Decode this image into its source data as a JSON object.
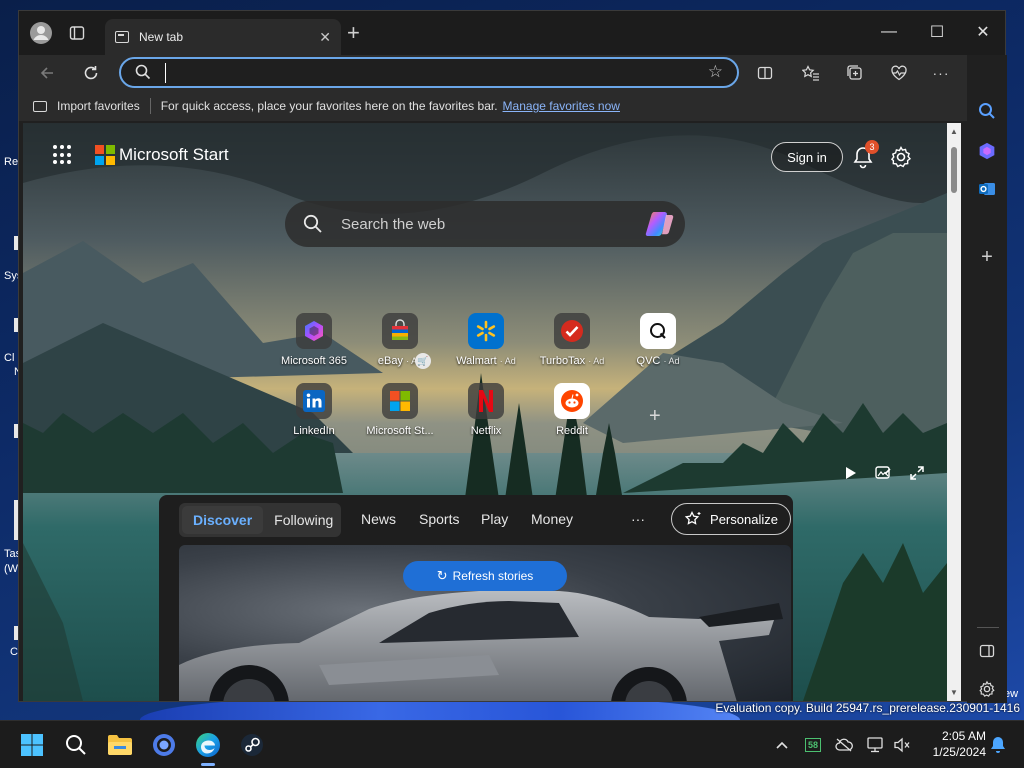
{
  "desktop": {
    "fragments": [
      "Re",
      "Sys",
      "Cl",
      "N",
      "Tas",
      "(W",
      "C"
    ],
    "watermark": "Evaluation copy. Build 25947.rs_prerelease.230901-1416",
    "right_fragment": "ew"
  },
  "browser": {
    "tab_title": "New tab",
    "tab_close": "✕",
    "new_tab": "+",
    "controls": {
      "minimize": "—",
      "maximize": "☐",
      "close": "✕"
    },
    "address": {
      "value": "",
      "placeholder": ""
    },
    "favorites_bar": {
      "import": "Import favorites",
      "hint": "For quick access, place your favorites here on the favorites bar.",
      "manage": "Manage favorites now"
    }
  },
  "page": {
    "brand": "Microsoft Start",
    "sign_in": "Sign in",
    "notification_count": "3",
    "search_placeholder": "Search the web",
    "quick_links": [
      {
        "label": "Microsoft 365",
        "ad": ""
      },
      {
        "label": "eBay",
        "ad": "· Ad"
      },
      {
        "label": "Walmart",
        "ad": "· Ad"
      },
      {
        "label": "TurboTax",
        "ad": "· Ad"
      },
      {
        "label": "QVC",
        "ad": "· Ad"
      },
      {
        "label": "LinkedIn",
        "ad": ""
      },
      {
        "label": "Microsoft St...",
        "ad": ""
      },
      {
        "label": "Netflix",
        "ad": ""
      },
      {
        "label": "Reddit",
        "ad": ""
      }
    ],
    "add_link": "+",
    "feed": {
      "tabs": [
        "Discover",
        "Following"
      ],
      "nav": [
        "News",
        "Sports",
        "Play",
        "Money",
        "···"
      ],
      "personalize": "Personalize",
      "refresh": "Refresh stories"
    }
  },
  "taskbar": {
    "tray_badge": "58",
    "time": "2:05 AM",
    "date": "1/25/2024"
  },
  "colors": {
    "accent": "#1f6fd6",
    "link": "#8ab4f8",
    "badge": "#e0502a",
    "ms_red": "#f25022",
    "ms_green": "#7fba00",
    "ms_blue": "#00a4ef",
    "ms_yellow": "#ffb900"
  }
}
